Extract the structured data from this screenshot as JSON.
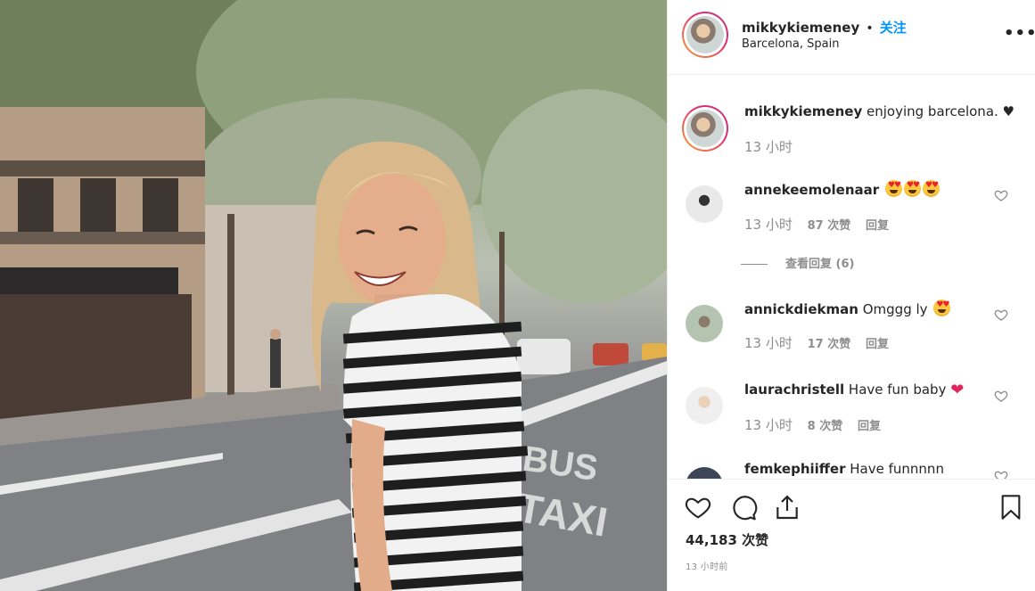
{
  "post": {
    "image_alt": "Smiling woman in a striped t-shirt on a tree-lined Barcelona street",
    "street_markings": [
      "BUS",
      "TAXI"
    ]
  },
  "header": {
    "username": "mikkykiemeney",
    "separator": "•",
    "follow_label": "关注",
    "location": "Barcelona, Spain",
    "more_icon": "more-options-icon"
  },
  "caption": {
    "username": "mikkykiemeney",
    "text": "enjoying barcelona. ♥",
    "time": "13 小时"
  },
  "comments": [
    {
      "username": "annekeemolenaar",
      "text": "",
      "emoji_count": 3,
      "time": "13 小时",
      "likes": "87 次赞",
      "reply": "回复"
    },
    {
      "username": "annickdiekman",
      "text": "Omggg ly",
      "emoji_count": 1,
      "time": "13 小时",
      "likes": "17 次赞",
      "reply": "回复"
    },
    {
      "username": "laurachristell",
      "text": "Have fun baby",
      "red_heart": "❤",
      "time": "13 小时",
      "likes": "8 次赞",
      "reply": "回复"
    },
    {
      "username": "femkephiiffer",
      "text": "Have funnnnn"
    }
  ],
  "view_replies": "查看回复 (6)",
  "actions": {
    "icons": [
      "heart-icon",
      "comment-icon",
      "share-icon",
      "bookmark-icon"
    ],
    "likes": "44,183 次赞",
    "time_ago": "13 小时前"
  },
  "colors": {
    "follow": "#0095f6",
    "muted": "#8e8e8e",
    "text": "#262626"
  }
}
